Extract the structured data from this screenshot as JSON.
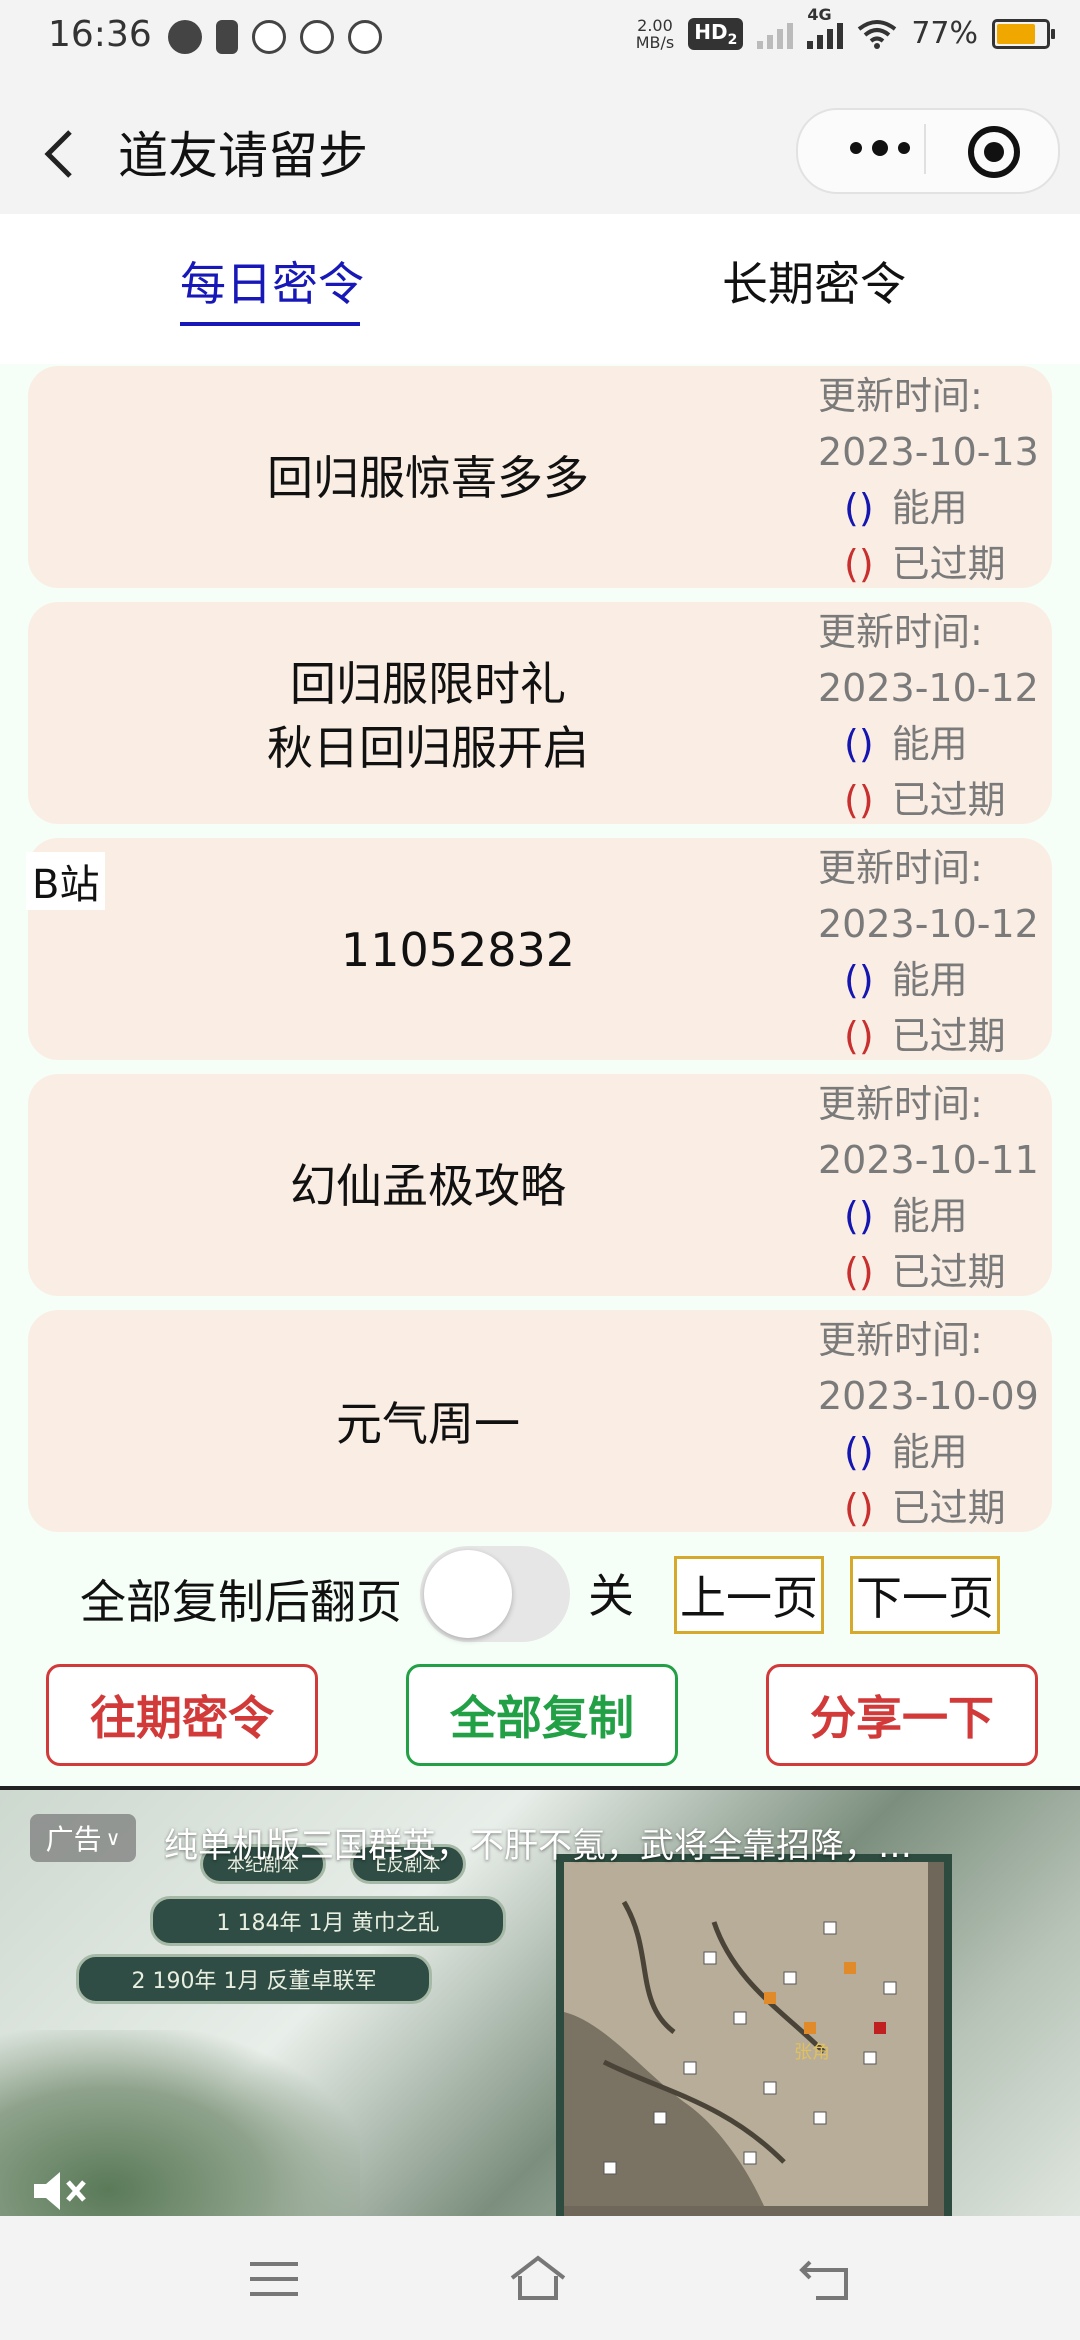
{
  "status_bar": {
    "time": "16:36",
    "network_speed_value": "2.00",
    "network_speed_unit": "MB/s",
    "hd_label": "HD",
    "hd_sub": "2",
    "signal_label": "4G",
    "battery": "77%",
    "battery_color": "#f0a800",
    "icons": [
      "chat-icon",
      "sim-icon",
      "phone-icon",
      "wechat-icon",
      "app-icon"
    ]
  },
  "header": {
    "back_icon": "chevron-left-icon",
    "title": "道友请留步",
    "capsule": [
      "more-icon",
      "target-icon"
    ]
  },
  "tabs": [
    {
      "label": "每日密令",
      "active": true
    },
    {
      "label": "长期密令",
      "active": false
    }
  ],
  "accent_color": "#1818b8",
  "cards": [
    {
      "text_lines": [
        "回归服惊喜多多"
      ],
      "update_label": "更新时间:",
      "date": "2023-10-13",
      "usable_mark": "()",
      "usable_label": "能用",
      "expired_mark": "()",
      "expired_label": "已过期"
    },
    {
      "text_lines": [
        "回归服限时礼",
        "秋日回归服开启"
      ],
      "update_label": "更新时间:",
      "date": "2023-10-12",
      "usable_mark": "()",
      "usable_label": "能用",
      "expired_mark": "()",
      "expired_label": "已过期"
    },
    {
      "tag": "B站",
      "text_lines": [
        "11052832"
      ],
      "update_label": "更新时间:",
      "date": "2023-10-12",
      "usable_mark": "()",
      "usable_label": "能用",
      "expired_mark": "()",
      "expired_label": "已过期"
    },
    {
      "text_lines": [
        "幻仙孟极攻略"
      ],
      "update_label": "更新时间:",
      "date": "2023-10-11",
      "usable_mark": "()",
      "usable_label": "能用",
      "expired_mark": "()",
      "expired_label": "已过期"
    },
    {
      "text_lines": [
        "元气周一"
      ],
      "update_label": "更新时间:",
      "date": "2023-10-09",
      "usable_mark": "()",
      "usable_label": "能用",
      "expired_mark": "()",
      "expired_label": "已过期"
    }
  ],
  "controls": {
    "copy_then_page_label": "全部复制后翻页",
    "toggle_state": "关",
    "prev_page": "上一页",
    "next_page": "下一页"
  },
  "actions": {
    "past": "往期密令",
    "copy_all": "全部复制",
    "share": "分享一下",
    "red": "#d23a3a",
    "green": "#22a045"
  },
  "ad": {
    "tag": "广告",
    "text": "纯单机版三国群英，不肝不氪，武将全靠招降，…",
    "scroll_items": [
      "本纪剧本",
      "E反剧本",
      "1 184年 1月 黄巾之乱",
      "2 190年 1月 反董卓联军"
    ],
    "map_label": "张角",
    "mute_icon": "muted-speaker-icon"
  },
  "nav_bar": [
    "menu-icon",
    "home-icon",
    "back-icon"
  ]
}
